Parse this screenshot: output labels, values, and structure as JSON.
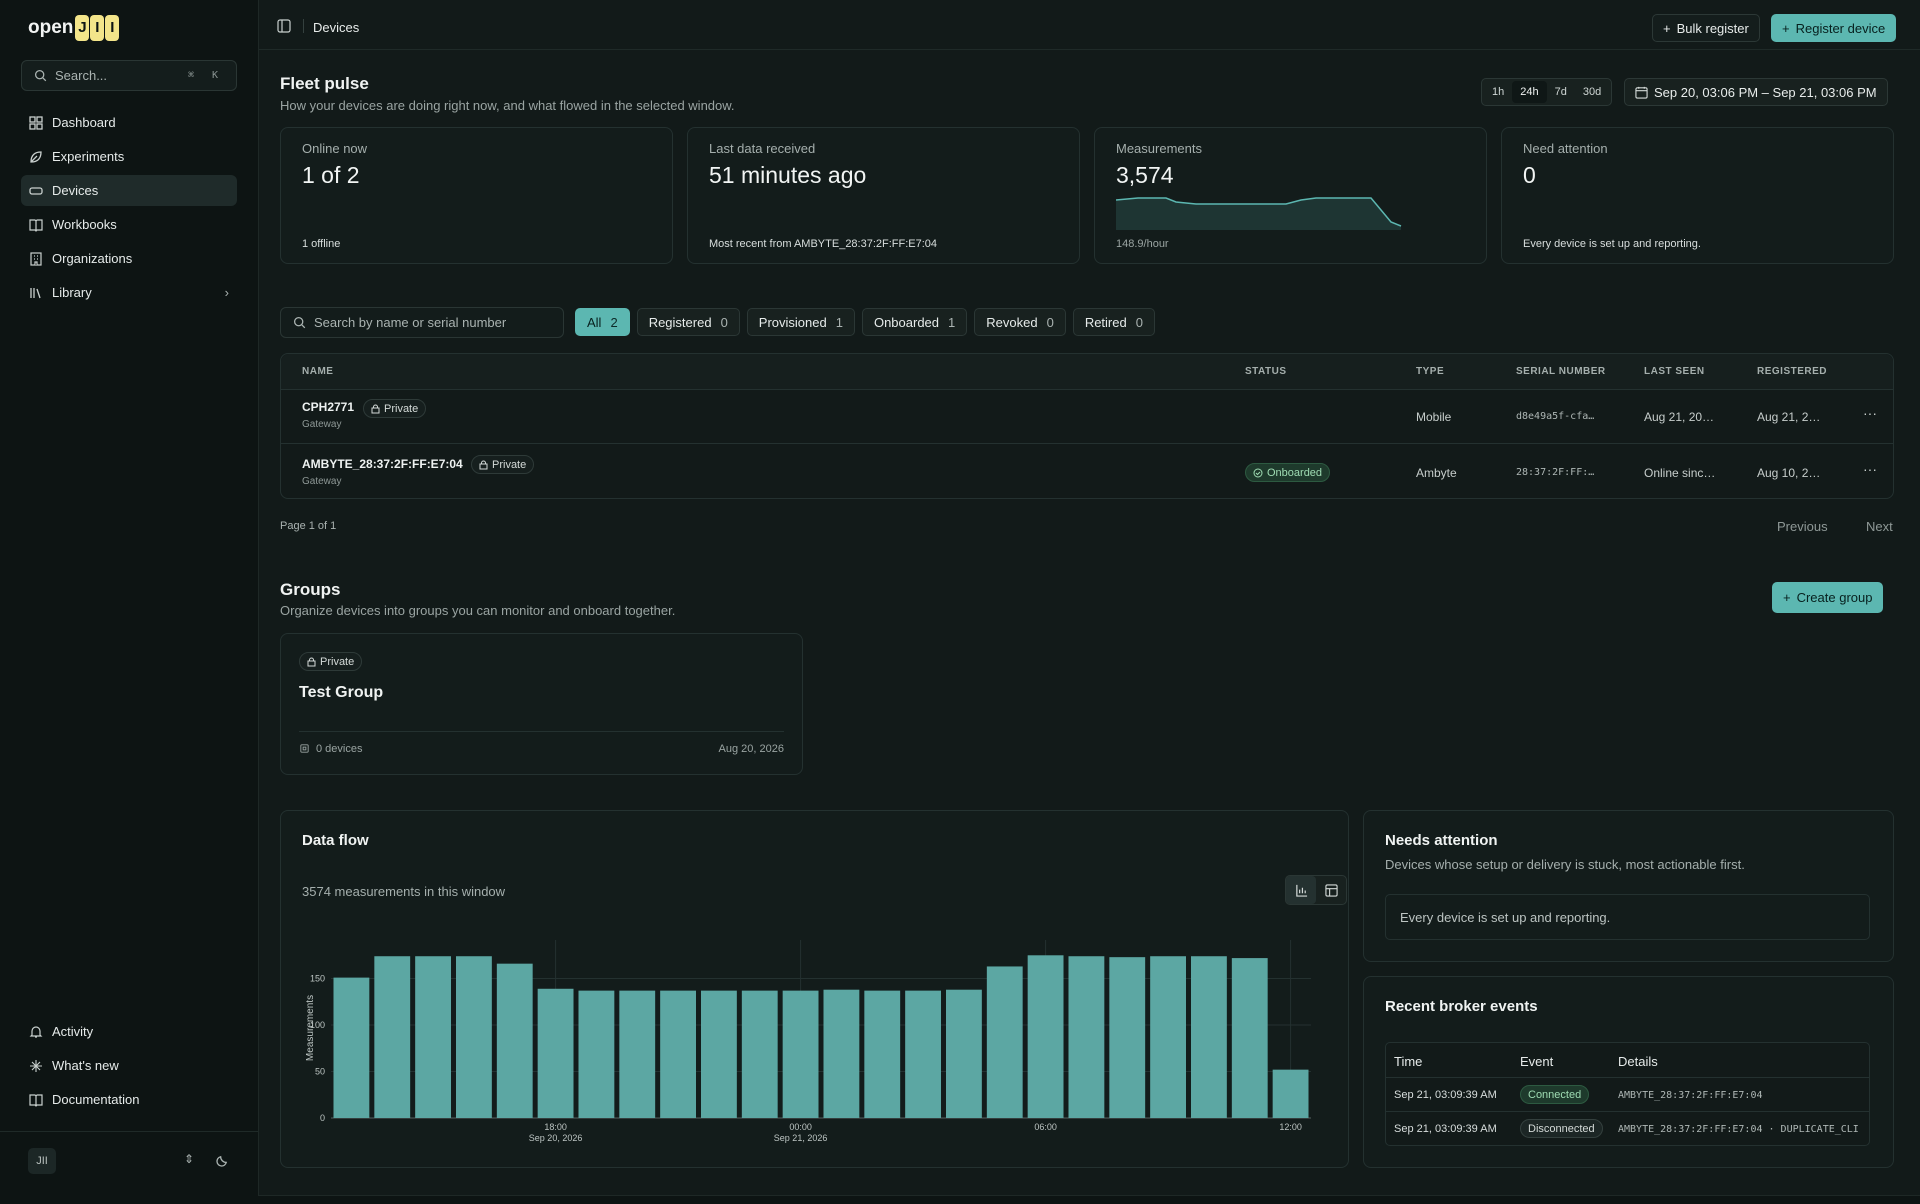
{
  "app": {
    "logo_text": "open",
    "logo_mark": "JII"
  },
  "sidebar": {
    "search_placeholder": "Search...",
    "search_shortcut": "⌘ K",
    "items": [
      {
        "label": "Dashboard",
        "icon": "grid-icon"
      },
      {
        "label": "Experiments",
        "icon": "leaf-icon"
      },
      {
        "label": "Devices",
        "icon": "device-icon",
        "active": true
      },
      {
        "label": "Workbooks",
        "icon": "book-icon"
      },
      {
        "label": "Organizations",
        "icon": "building-icon"
      },
      {
        "label": "Library",
        "icon": "library-icon"
      }
    ],
    "footer_items": [
      {
        "label": "Activity",
        "icon": "bell-icon"
      },
      {
        "label": "What's new",
        "icon": "sparkle-icon"
      },
      {
        "label": "Documentation",
        "icon": "book-open-icon"
      }
    ],
    "user_initials": "JII"
  },
  "topbar": {
    "breadcrumb": "Devices",
    "bulk_register": "Bulk register",
    "register_device": "Register device"
  },
  "fleet": {
    "title": "Fleet pulse",
    "subtitle": "How your devices are doing right now, and what flowed in the selected window.",
    "ranges": [
      "1h",
      "24h",
      "7d",
      "30d"
    ],
    "active_range": "24h",
    "date_range": "Sep 20, 03:06 PM – Sep 21, 03:06 PM",
    "kpis": [
      {
        "label": "Online now",
        "value": "1 of 2",
        "foot": "1 offline"
      },
      {
        "label": "Last data received",
        "value": "51 minutes ago",
        "foot": "Most recent from AMBYTE_28:37:2F:FF:E7:04"
      },
      {
        "label": "Measurements",
        "value": "3,574",
        "foot": "148.9/hour"
      },
      {
        "label": "Need attention",
        "value": "0",
        "foot": "Every device is set up and reporting."
      }
    ]
  },
  "filters": {
    "search_placeholder": "Search by name or serial number",
    "tabs": [
      {
        "label": "All",
        "count": "2"
      },
      {
        "label": "Registered",
        "count": "0"
      },
      {
        "label": "Provisioned",
        "count": "1"
      },
      {
        "label": "Onboarded",
        "count": "1"
      },
      {
        "label": "Revoked",
        "count": "0"
      },
      {
        "label": "Retired",
        "count": "0"
      }
    ]
  },
  "table": {
    "headers": [
      "NAME",
      "STATUS",
      "TYPE",
      "SERIAL NUMBER",
      "LAST SEEN",
      "REGISTERED"
    ],
    "rows": [
      {
        "name": "CPH2771",
        "visibility": "Private",
        "kind": "Gateway",
        "status": "",
        "type": "Mobile",
        "serial": "d8e49a5f-cfa…",
        "last_seen": "Aug 21, 20…",
        "registered": "Aug 21, 2…"
      },
      {
        "name": "AMBYTE_28:37:2F:FF:E7:04",
        "visibility": "Private",
        "kind": "Gateway",
        "status": "Onboarded",
        "type": "Ambyte",
        "serial": "28:37:2F:FF:…",
        "last_seen": "Online sinc…",
        "registered": "Aug 10, 2…"
      }
    ],
    "page_info": "Page 1 of 1",
    "previous": "Previous",
    "next": "Next"
  },
  "groups": {
    "title": "Groups",
    "subtitle": "Organize devices into groups you can monitor and onboard together.",
    "create": "Create group",
    "card": {
      "visibility": "Private",
      "name": "Test Group",
      "devices": "0 devices",
      "date": "Aug 20, 2026"
    }
  },
  "dataflow": {
    "title": "Data flow",
    "summary": "3574 measurements in this window"
  },
  "chart_data": {
    "type": "bar",
    "ylabel": "Measurements",
    "ylim": [
      0,
      185
    ],
    "yticks": [
      0,
      50,
      100,
      150
    ],
    "x_ticks": [
      {
        "label": "18:00",
        "sub": "Sep 20, 2026",
        "index": 5.5
      },
      {
        "label": "00:00",
        "sub": "Sep 21, 2026",
        "index": 11.5
      },
      {
        "label": "06:00",
        "sub": "",
        "index": 17.5
      },
      {
        "label": "12:00",
        "sub": "",
        "index": 23.5
      }
    ],
    "values": [
      151,
      174,
      174,
      174,
      166,
      139,
      137,
      137,
      137,
      137,
      137,
      137,
      138,
      137,
      137,
      138,
      163,
      175,
      174,
      173,
      174,
      174,
      172,
      52
    ]
  },
  "attention": {
    "title": "Needs attention",
    "subtitle": "Devices whose setup or delivery is stuck, most actionable first.",
    "empty": "Every device is set up and reporting."
  },
  "broker": {
    "title": "Recent broker events",
    "headers": [
      "Time",
      "Event",
      "Details"
    ],
    "rows": [
      {
        "time": "Sep 21, 03:09:39 AM",
        "event": "Connected",
        "details": "AMBYTE_28:37:2F:FF:E7:04"
      },
      {
        "time": "Sep 21, 03:09:39 AM",
        "event": "Disconnected",
        "details": "AMBYTE_28:37:2F:FF:E7:04 · DUPLICATE_CLI"
      }
    ]
  },
  "colors": {
    "accent": "#5cb7b1",
    "bar": "#5ca7a3",
    "background": "#121a19"
  }
}
